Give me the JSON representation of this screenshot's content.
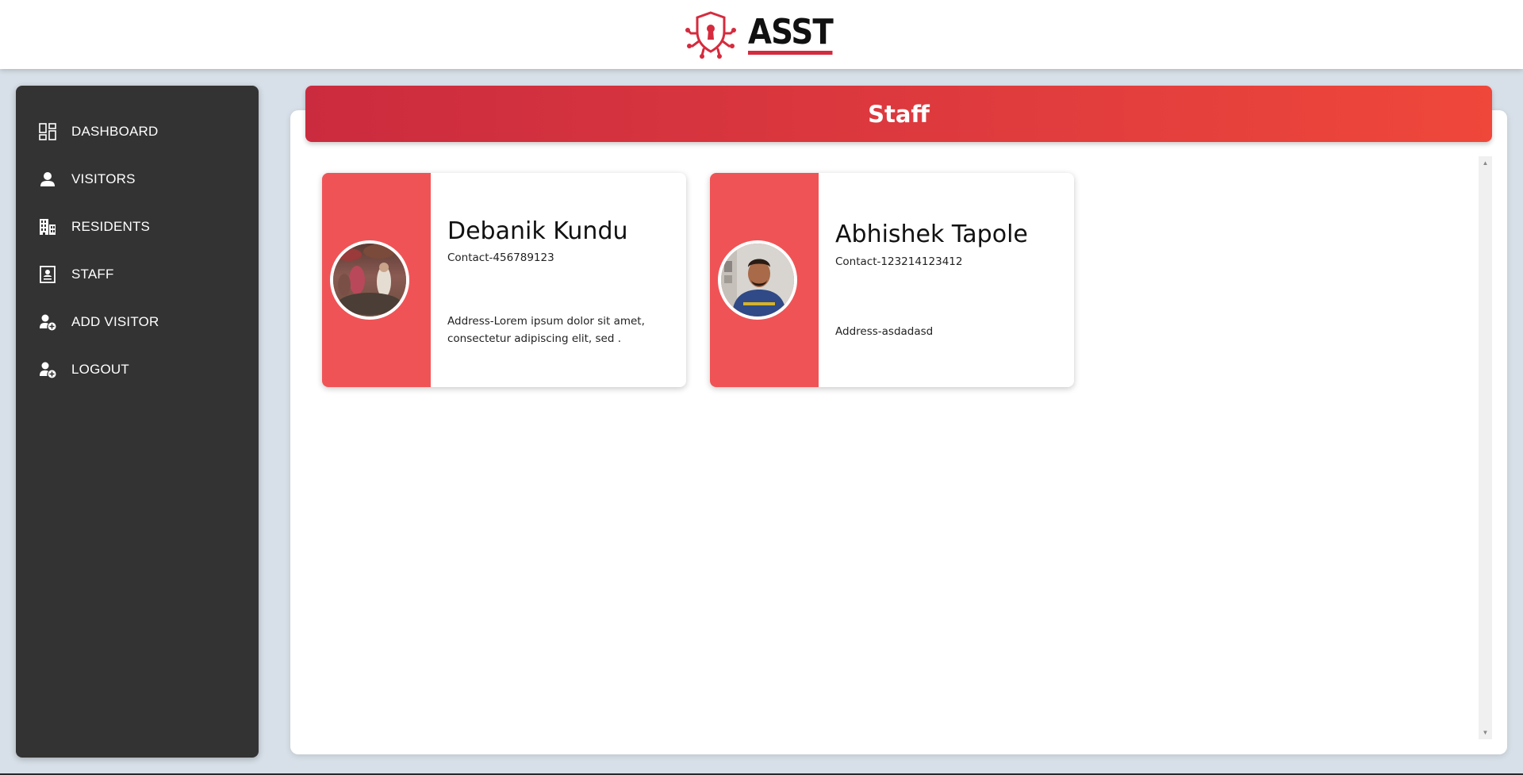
{
  "header": {
    "brand": "ASST",
    "logo_icon": "shield-keyhole-circuit-icon",
    "accent": "#d52b3e"
  },
  "sidebar": {
    "background": "#333333",
    "items": [
      {
        "label": "DASHBOARD",
        "icon": "dashboard-icon"
      },
      {
        "label": "VISITORS",
        "icon": "person-icon"
      },
      {
        "label": "RESIDENTS",
        "icon": "building-icon"
      },
      {
        "label": "STAFF",
        "icon": "id-card-icon"
      },
      {
        "label": "ADD VISITOR",
        "icon": "add-user-icon"
      },
      {
        "label": "LOGOUT",
        "icon": "logout-user-icon"
      }
    ]
  },
  "main": {
    "title": "Staff",
    "header_gradient": [
      "#cb2b3e",
      "#ef473a"
    ],
    "staff": [
      {
        "name": "Debanik Kundu",
        "contact": "Contact-456789123",
        "address": "Address-Lorem ipsum dolor sit amet, consectetur adipiscing elit, sed ."
      },
      {
        "name": "Abhishek Tapole",
        "contact": "Contact-123214123412",
        "address": "Address-asdadasd"
      }
    ],
    "card_accent": "#f05356"
  }
}
